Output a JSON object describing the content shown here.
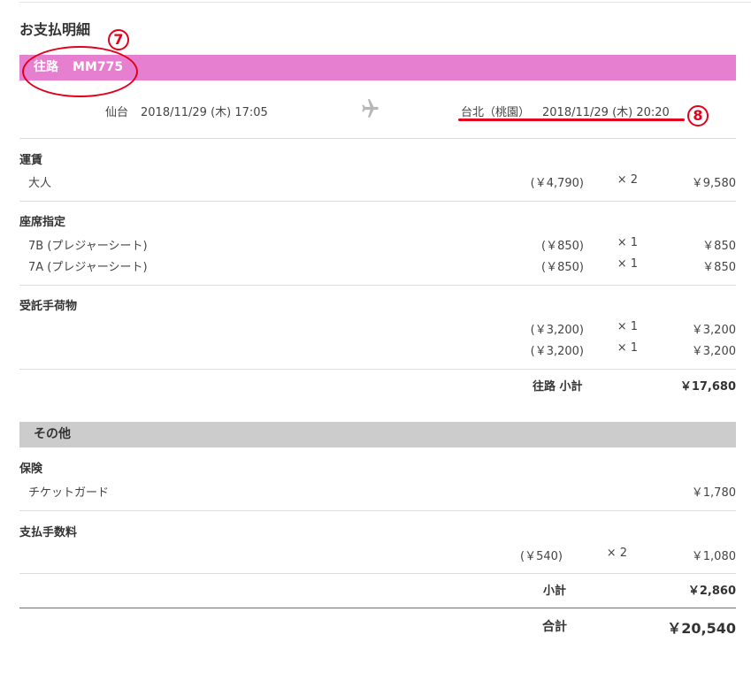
{
  "page_title": "お支払明細",
  "flight": {
    "direction": "往路",
    "code": "MM775",
    "departure": {
      "city": "仙台",
      "datetime": "2018/11/29 (木) 17:05"
    },
    "arrival": {
      "city": "台北（桃園）",
      "datetime": "2018/11/29 (木) 20:20"
    }
  },
  "fare": {
    "title": "運賃",
    "rows": [
      {
        "label": "大人",
        "unit": "(￥4,790)",
        "qty": "× 2",
        "amount": "￥9,580"
      }
    ]
  },
  "seats": {
    "title": "座席指定",
    "rows": [
      {
        "label": "7B (プレジャーシート)",
        "unit": "(￥850)",
        "qty": "× 1",
        "amount": "￥850"
      },
      {
        "label": "7A (プレジャーシート)",
        "unit": "(￥850)",
        "qty": "× 1",
        "amount": "￥850"
      }
    ]
  },
  "baggage": {
    "title": "受託手荷物",
    "rows": [
      {
        "label": "",
        "unit": "(￥3,200)",
        "qty": "× 1",
        "amount": "￥3,200"
      },
      {
        "label": "",
        "unit": "(￥3,200)",
        "qty": "× 1",
        "amount": "￥3,200"
      }
    ]
  },
  "outbound_subtotal": {
    "label": "往路 小計",
    "amount": "￥17,680"
  },
  "other": {
    "title": "その他",
    "insurance": {
      "title": "保険",
      "rows": [
        {
          "label": "チケットガード",
          "amount": "￥1,780"
        }
      ]
    },
    "payment_fee": {
      "title": "支払手数料",
      "rows": [
        {
          "unit": "(￥540)",
          "qty": "× 2",
          "amount": "￥1,080"
        }
      ]
    },
    "subtotal": {
      "label": "小計",
      "amount": "￥2,860"
    }
  },
  "total": {
    "label": "合計",
    "amount": "￥20,540"
  },
  "annotations": {
    "seven": "7",
    "eight": "8"
  },
  "colors": {
    "flight_band": "#e77fd0",
    "other_band": "#cccccc",
    "annotation": "#e3001b"
  }
}
